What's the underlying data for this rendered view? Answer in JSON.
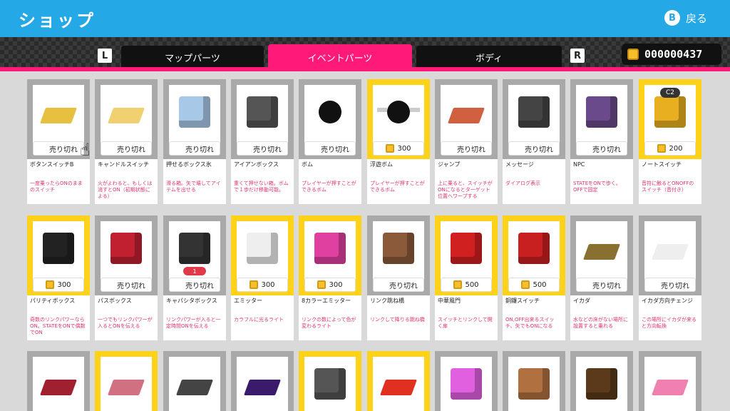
{
  "header": {
    "title": "ショップ",
    "back_button": "B",
    "back_label": "戻る"
  },
  "tabs": {
    "left_shoulder": "L",
    "right_shoulder": "R",
    "items": [
      {
        "label": "マップパーツ",
        "active": false
      },
      {
        "label": "イベントパーツ",
        "active": true
      },
      {
        "label": "ボディ",
        "active": false
      }
    ]
  },
  "coins": {
    "icon": "coin-icon",
    "amount": "000000437"
  },
  "items": [
    {
      "name": "ボタンスイッチB",
      "desc": "一度乗ったらONのままのスイッチ",
      "status": "売り切れ",
      "style": "gray",
      "color": "#e8c040"
    },
    {
      "name": "キャンドルスイッチ",
      "desc": "火がよわると、もしくは消すとON（初期状態による）",
      "status": "売り切れ",
      "style": "gray",
      "color": "#f0d070"
    },
    {
      "name": "押せるボックス氷",
      "desc": "滑る箱。矢で壊してアイテムを出せる",
      "status": "売り切れ",
      "style": "gray",
      "color": "#a8c8e8"
    },
    {
      "name": "アイアンボックス",
      "desc": "重くて押せない箱。ボムで１歩だけ移動可能。",
      "status": "売り切れ",
      "style": "gray",
      "color": "#555555"
    },
    {
      "name": "ボム",
      "desc": "プレイヤーが押すことができるボム",
      "status": "売り切れ",
      "style": "gray",
      "color": "#111111"
    },
    {
      "name": "浮遊ボム",
      "desc": "プレイヤーが押すことができるボム",
      "status": "300",
      "style": "yellow",
      "color": "#111111"
    },
    {
      "name": "ジャンプ",
      "desc": "上に乗ると、スイッチがONになるとターゲット位置へワープする",
      "status": "売り切れ",
      "style": "gray",
      "color": "#d06040"
    },
    {
      "name": "メッセージ",
      "desc": "ダイアログ表示",
      "status": "売り切れ",
      "style": "gray",
      "color": "#444444"
    },
    {
      "name": "NPC",
      "desc": "STATEをONで歩く。OFFで固定",
      "status": "売り切れ",
      "style": "gray",
      "color": "#6a4a8a"
    },
    {
      "name": "ノートスイッチ",
      "desc": "音符に触るとONOFFのスイッチ（音付き）",
      "status": "200",
      "style": "yellow",
      "color": "#e8b020",
      "tag": "C2"
    },
    {
      "name": "パリティボックス",
      "desc": "奇数のリンクパワーならON。STATEをONで偶数でON",
      "status": "300",
      "style": "yellow",
      "color": "#222222"
    },
    {
      "name": "パスボックス",
      "desc": "一つでもリンクパワーが入るとONを伝える",
      "status": "売り切れ",
      "style": "gray",
      "color": "#c02030"
    },
    {
      "name": "キャパシタボックス",
      "desc": "リンクパワーが入ると一定時間ONを伝える",
      "status": "売り切れ",
      "style": "gray",
      "color": "#333333",
      "tag": "1"
    },
    {
      "name": "エミッター",
      "desc": "カラフルに光るライト",
      "status": "300",
      "style": "yellow",
      "color": "#eeeeee"
    },
    {
      "name": "8カラーエミッター",
      "desc": "リンクの数によって色が変わるライト",
      "status": "300",
      "style": "yellow",
      "color": "#e040a0"
    },
    {
      "name": "リンク跳ね橋",
      "desc": "リンクして降りる跳ね橋",
      "status": "売り切れ",
      "style": "gray",
      "color": "#8a5a3a"
    },
    {
      "name": "中華風門",
      "desc": "スイッチとリンクして開く扉",
      "status": "500",
      "style": "yellow",
      "color": "#d02020"
    },
    {
      "name": "銅鑼スイッチ",
      "desc": "ON,OFF出来るスイッチ、矢でもONになる",
      "status": "500",
      "style": "yellow",
      "color": "#c82020"
    },
    {
      "name": "イカダ",
      "desc": "水などの床がない場所に設置すると乗れる",
      "status": "売り切れ",
      "style": "gray",
      "color": "#8a7030"
    },
    {
      "name": "イカダ方向チェンジ",
      "desc": "この場所にイカダが来ると方向転換",
      "status": "売り切れ",
      "style": "gray",
      "color": "#eeeeee"
    },
    {
      "name": "",
      "desc": "",
      "status": "",
      "style": "gray",
      "color": "#a02030"
    },
    {
      "name": "",
      "desc": "",
      "status": "",
      "style": "yellow",
      "color": "#d07080"
    },
    {
      "name": "",
      "desc": "",
      "status": "",
      "style": "gray",
      "color": "#444444"
    },
    {
      "name": "",
      "desc": "",
      "status": "",
      "style": "gray",
      "color": "#3a1a6a"
    },
    {
      "name": "",
      "desc": "",
      "status": "",
      "style": "yellow",
      "color": "#555555"
    },
    {
      "name": "",
      "desc": "",
      "status": "",
      "style": "yellow",
      "color": "#e03020"
    },
    {
      "name": "",
      "desc": "",
      "status": "",
      "style": "gray",
      "color": "#e060e0"
    },
    {
      "name": "",
      "desc": "",
      "status": "",
      "style": "gray",
      "color": "#b07040"
    },
    {
      "name": "",
      "desc": "",
      "status": "",
      "style": "gray",
      "color": "#5a3a1a"
    },
    {
      "name": "",
      "desc": "",
      "status": "",
      "style": "gray",
      "color": "#f080b0"
    }
  ]
}
